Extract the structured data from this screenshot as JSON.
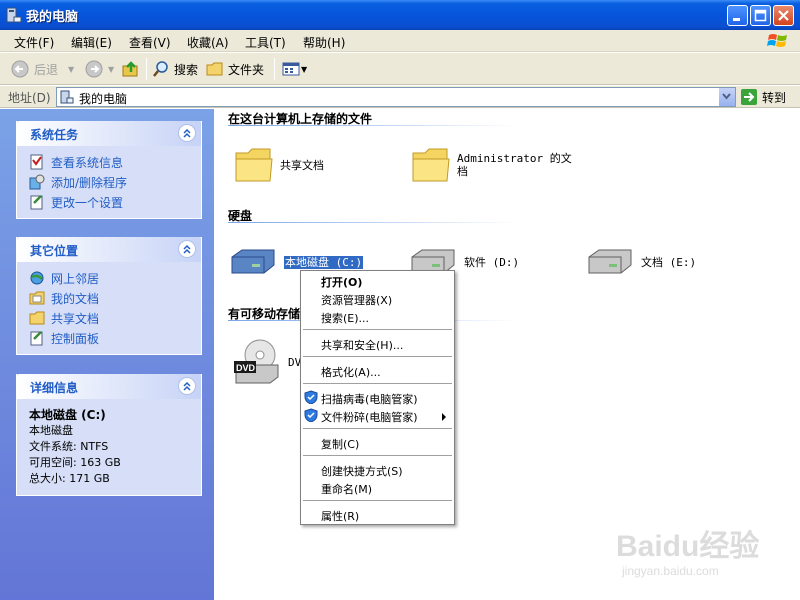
{
  "window": {
    "title": "我的电脑"
  },
  "menubar": {
    "items": [
      "文件(F)",
      "编辑(E)",
      "查看(V)",
      "收藏(A)",
      "工具(T)",
      "帮助(H)"
    ]
  },
  "toolbar": {
    "back_label": "后退",
    "search_label": "搜索",
    "folders_label": "文件夹"
  },
  "addressbar": {
    "label": "地址(D)",
    "value": "我的电脑",
    "go_label": "转到"
  },
  "left_pane": {
    "system_tasks": {
      "title": "系统任务",
      "items": [
        "查看系统信息",
        "添加/删除程序",
        "更改一个设置"
      ]
    },
    "other_places": {
      "title": "其它位置",
      "items": [
        "网上邻居",
        "我的文档",
        "共享文档",
        "控制面板"
      ]
    },
    "details": {
      "title": "详细信息",
      "name": "本地磁盘 (C:)",
      "type": "本地磁盘",
      "filesystem": "文件系统: NTFS",
      "free": "可用空间: 163 GB",
      "total": "总大小: 171 GB"
    }
  },
  "content": {
    "groups": {
      "files": "在这台计算机上存储的文件",
      "hard_disks": "硬盘",
      "removable": "有可移动存储"
    },
    "files": [
      "共享文档",
      "Administrator 的文档"
    ],
    "drives": [
      "本地磁盘 (C:)",
      "软件 (D:)",
      "文档 (E:)"
    ],
    "dvd_label": "DVD",
    "dvd_icon_text": "DVD"
  },
  "context_menu": {
    "items": [
      "打开(O)",
      "资源管理器(X)",
      "搜索(E)...",
      "共享和安全(H)...",
      "格式化(A)...",
      "扫描病毒(电脑管家)",
      "文件粉碎(电脑管家)",
      "复制(C)",
      "创建快捷方式(S)",
      "重命名(M)",
      "属性(R)"
    ]
  },
  "watermark": {
    "brand": "Baidu经验",
    "url": "jingyan.baidu.com"
  },
  "colors": {
    "titlebar": "#0655dc",
    "left_pane": "#7ba2e7",
    "panel_title": "#215dc6",
    "selection": "#316ac5"
  }
}
